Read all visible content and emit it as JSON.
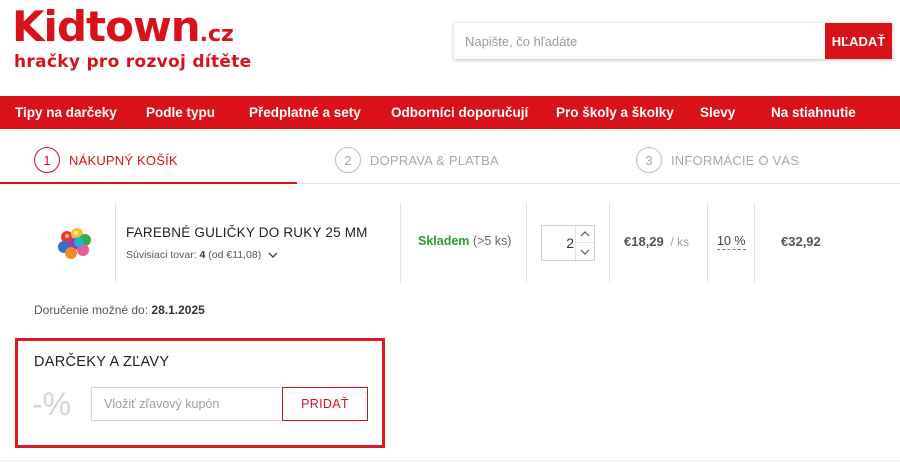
{
  "brand": {
    "logo_main": "Kidtown",
    "logo_tld": ".cz",
    "tagline": "hračky pro rozvoj dítěte",
    "accent_color": "#d9121a"
  },
  "search": {
    "placeholder": "Napište, čo hľadáte",
    "value": "",
    "button_label": "HĽADAŤ"
  },
  "nav": {
    "items": [
      {
        "label": "Tipy na darčeky"
      },
      {
        "label": "Podle typu"
      },
      {
        "label": "Předplatné a sety"
      },
      {
        "label": "Odborníci doporučují"
      },
      {
        "label": "Pro školy a školky"
      },
      {
        "label": "Slevy"
      },
      {
        "label": "Na stiahnutie"
      }
    ]
  },
  "steps": [
    {
      "number": "1",
      "label": "NÁKUPNÝ KOŠÍK",
      "active": true
    },
    {
      "number": "2",
      "label": "DOPRAVA & PLATBA",
      "active": false
    },
    {
      "number": "3",
      "label": "INFORMÁCIE O VÁS",
      "active": false
    }
  ],
  "cart": {
    "items": [
      {
        "image_icon": "colorful-balls-image",
        "name": "FAREBNÉ GULIČKY DO RUKY 25 MM",
        "related_prefix": "Súvisiaci tovar:",
        "related_count": "4",
        "related_from": "(od €11,08)",
        "stock_status": "Skladem",
        "stock_qty": "(>5 ks)",
        "stock_color": "#2e9b2e",
        "quantity": "2",
        "unit_price": "€18,29",
        "unit": "/ ks",
        "vat": "10 %",
        "total": "€32,92"
      }
    ]
  },
  "delivery": {
    "label": "Doručenie možné do:",
    "date": "28.1.2025"
  },
  "discounts": {
    "title": "DARČEKY A ZĽAVY",
    "percent_symbol": "-%",
    "coupon_placeholder": "Vložiť zľavový kupón",
    "coupon_value": "",
    "add_button": "PRIDAŤ"
  }
}
